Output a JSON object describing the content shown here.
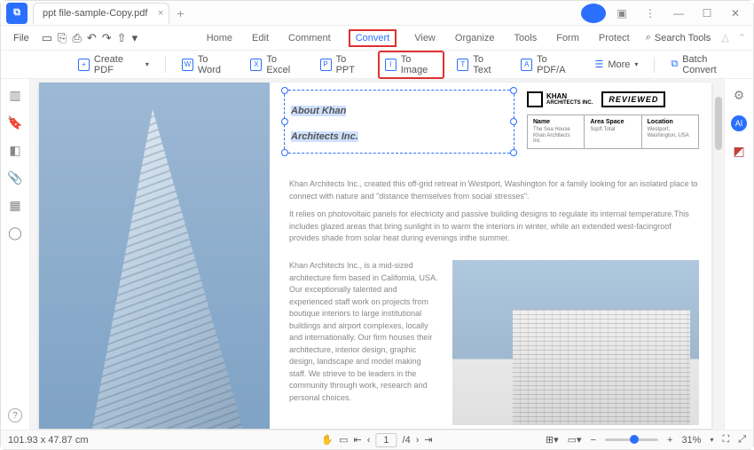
{
  "titlebar": {
    "tab_title": "ppt file-sample-Copy.pdf"
  },
  "menubar": {
    "file": "File",
    "items": [
      "Home",
      "Edit",
      "Comment",
      "Convert",
      "View",
      "Organize",
      "Tools",
      "Form",
      "Protect"
    ],
    "highlighted": "Convert",
    "search_placeholder": "Search Tools"
  },
  "ribbon": {
    "create": "Create PDF",
    "items": [
      {
        "icon": "W",
        "label": "To Word"
      },
      {
        "icon": "X",
        "label": "To Excel"
      },
      {
        "icon": "P",
        "label": "To PPT"
      },
      {
        "icon": "I",
        "label": "To Image"
      },
      {
        "icon": "T",
        "label": "To Text"
      },
      {
        "icon": "A",
        "label": "To PDF/A"
      }
    ],
    "highlighted": "To Image",
    "more": "More",
    "batch": "Batch Convert"
  },
  "document": {
    "title_line1": "About Khan",
    "title_line2": "Architects Inc.",
    "logo_line1": "KHAN",
    "logo_line2": "ARCHITECTS INC.",
    "stamp": "REVIEWED",
    "info": [
      {
        "h": "Name",
        "v": "The Sea House Khan Architects Inc"
      },
      {
        "h": "Area Space",
        "v": "Sqsft Total"
      },
      {
        "h": "Location",
        "v": "Westport, Washington, USA"
      }
    ],
    "p1": "Khan Architects Inc., created this off-grid retreat in Westport, Washington for a family looking for an isolated place to connect with nature and \"distance themselves from social stresses\".",
    "p2": "It relies on photovoltaic panels for electricity and passive building designs to regulate its internal temperature.This includes glazed areas that bring sunlight in to warm the interiors in winter, while an extended west-facingroof provides shade from solar heat during evenings inthe summer.",
    "p3": "Khan Architects Inc., is a mid-sized architecture firm based in California, USA. Our exceptionally talented and experienced staff work on projects from boutique interiors to large institutional buildings and airport complexes, locally and internationally. Our firm houses their architecture, interior design, graphic design, landscape and model making staff. We strieve to be leaders in the community through work, research and personal choices."
  },
  "statusbar": {
    "dims": "101.93 x 47.87 cm",
    "page_current": "1",
    "page_total": "/4",
    "zoom": "31%"
  }
}
